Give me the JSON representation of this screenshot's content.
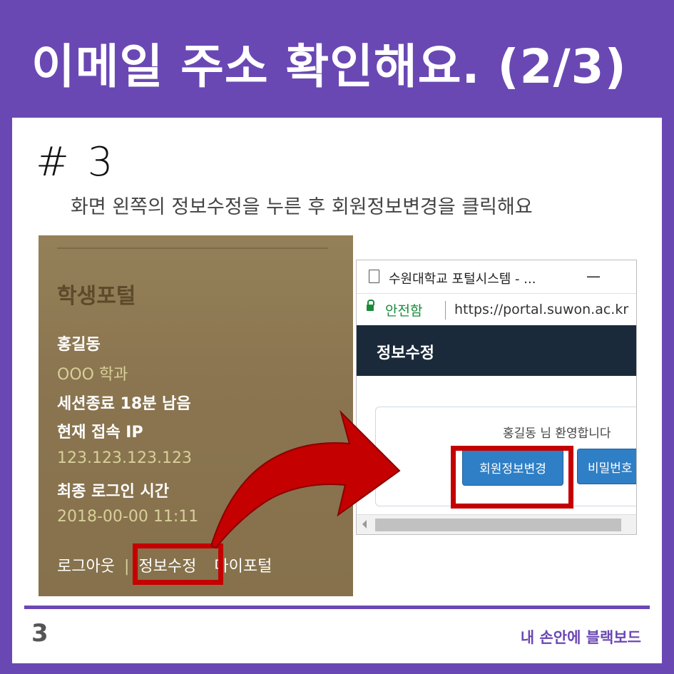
{
  "header": {
    "title": "이메일 주소 확인해요. (2/3)"
  },
  "step": {
    "number": "# 3",
    "description": "화면 왼쪽의 정보수정을 누른 후 회원정보변경을 클릭해요"
  },
  "left_panel": {
    "title": "학생포털",
    "name": "홍길동",
    "department": "OOO 학과",
    "session": "세션종료 18분 남음",
    "current_ip_label": "현재 접속 IP",
    "ip": "123.123.123.123",
    "last_login_label": "최종 로그인 시간",
    "last_login": "2018-00-00 11:11",
    "links": {
      "logout": "로그아웃",
      "divider": "|",
      "edit_info": "정보수정",
      "myportal": "마이포털"
    }
  },
  "browser": {
    "tab_title": "수원대학교 포털시스템 - ...",
    "minimize": "—",
    "secure_label": "안전함",
    "url": "https://portal.suwon.ac.kr",
    "page_title": "정보수정",
    "welcome": "홍길동 님 환영합니다",
    "btn_member_change": "회원정보변경",
    "btn_password": "비밀번호"
  },
  "footer": {
    "page_number": "3",
    "brand": "내 손안에 블랙보드"
  },
  "colors": {
    "accent": "#6a48b4",
    "highlight": "#c40000",
    "panel_brown": "#8a7550",
    "button_blue": "#2f7fc6"
  }
}
